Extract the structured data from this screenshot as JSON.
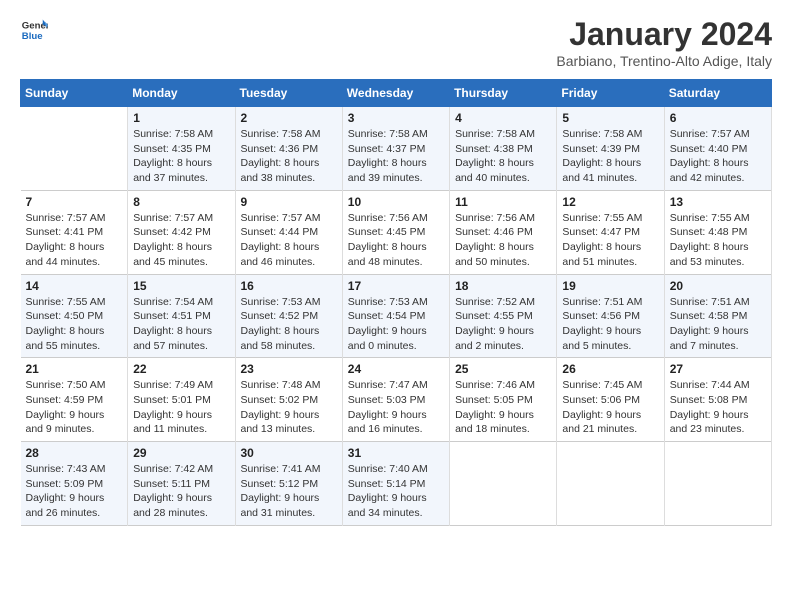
{
  "header": {
    "logo": {
      "line1": "General",
      "line2": "Blue"
    },
    "title": "January 2024",
    "location": "Barbiano, Trentino-Alto Adige, Italy"
  },
  "weekdays": [
    "Sunday",
    "Monday",
    "Tuesday",
    "Wednesday",
    "Thursday",
    "Friday",
    "Saturday"
  ],
  "weeks": [
    [
      {
        "day": "",
        "sunrise": "",
        "sunset": "",
        "daylight": ""
      },
      {
        "day": "1",
        "sunrise": "Sunrise: 7:58 AM",
        "sunset": "Sunset: 4:35 PM",
        "daylight": "Daylight: 8 hours and 37 minutes."
      },
      {
        "day": "2",
        "sunrise": "Sunrise: 7:58 AM",
        "sunset": "Sunset: 4:36 PM",
        "daylight": "Daylight: 8 hours and 38 minutes."
      },
      {
        "day": "3",
        "sunrise": "Sunrise: 7:58 AM",
        "sunset": "Sunset: 4:37 PM",
        "daylight": "Daylight: 8 hours and 39 minutes."
      },
      {
        "day": "4",
        "sunrise": "Sunrise: 7:58 AM",
        "sunset": "Sunset: 4:38 PM",
        "daylight": "Daylight: 8 hours and 40 minutes."
      },
      {
        "day": "5",
        "sunrise": "Sunrise: 7:58 AM",
        "sunset": "Sunset: 4:39 PM",
        "daylight": "Daylight: 8 hours and 41 minutes."
      },
      {
        "day": "6",
        "sunrise": "Sunrise: 7:57 AM",
        "sunset": "Sunset: 4:40 PM",
        "daylight": "Daylight: 8 hours and 42 minutes."
      }
    ],
    [
      {
        "day": "7",
        "sunrise": "Sunrise: 7:57 AM",
        "sunset": "Sunset: 4:41 PM",
        "daylight": "Daylight: 8 hours and 44 minutes."
      },
      {
        "day": "8",
        "sunrise": "Sunrise: 7:57 AM",
        "sunset": "Sunset: 4:42 PM",
        "daylight": "Daylight: 8 hours and 45 minutes."
      },
      {
        "day": "9",
        "sunrise": "Sunrise: 7:57 AM",
        "sunset": "Sunset: 4:44 PM",
        "daylight": "Daylight: 8 hours and 46 minutes."
      },
      {
        "day": "10",
        "sunrise": "Sunrise: 7:56 AM",
        "sunset": "Sunset: 4:45 PM",
        "daylight": "Daylight: 8 hours and 48 minutes."
      },
      {
        "day": "11",
        "sunrise": "Sunrise: 7:56 AM",
        "sunset": "Sunset: 4:46 PM",
        "daylight": "Daylight: 8 hours and 50 minutes."
      },
      {
        "day": "12",
        "sunrise": "Sunrise: 7:55 AM",
        "sunset": "Sunset: 4:47 PM",
        "daylight": "Daylight: 8 hours and 51 minutes."
      },
      {
        "day": "13",
        "sunrise": "Sunrise: 7:55 AM",
        "sunset": "Sunset: 4:48 PM",
        "daylight": "Daylight: 8 hours and 53 minutes."
      }
    ],
    [
      {
        "day": "14",
        "sunrise": "Sunrise: 7:55 AM",
        "sunset": "Sunset: 4:50 PM",
        "daylight": "Daylight: 8 hours and 55 minutes."
      },
      {
        "day": "15",
        "sunrise": "Sunrise: 7:54 AM",
        "sunset": "Sunset: 4:51 PM",
        "daylight": "Daylight: 8 hours and 57 minutes."
      },
      {
        "day": "16",
        "sunrise": "Sunrise: 7:53 AM",
        "sunset": "Sunset: 4:52 PM",
        "daylight": "Daylight: 8 hours and 58 minutes."
      },
      {
        "day": "17",
        "sunrise": "Sunrise: 7:53 AM",
        "sunset": "Sunset: 4:54 PM",
        "daylight": "Daylight: 9 hours and 0 minutes."
      },
      {
        "day": "18",
        "sunrise": "Sunrise: 7:52 AM",
        "sunset": "Sunset: 4:55 PM",
        "daylight": "Daylight: 9 hours and 2 minutes."
      },
      {
        "day": "19",
        "sunrise": "Sunrise: 7:51 AM",
        "sunset": "Sunset: 4:56 PM",
        "daylight": "Daylight: 9 hours and 5 minutes."
      },
      {
        "day": "20",
        "sunrise": "Sunrise: 7:51 AM",
        "sunset": "Sunset: 4:58 PM",
        "daylight": "Daylight: 9 hours and 7 minutes."
      }
    ],
    [
      {
        "day": "21",
        "sunrise": "Sunrise: 7:50 AM",
        "sunset": "Sunset: 4:59 PM",
        "daylight": "Daylight: 9 hours and 9 minutes."
      },
      {
        "day": "22",
        "sunrise": "Sunrise: 7:49 AM",
        "sunset": "Sunset: 5:01 PM",
        "daylight": "Daylight: 9 hours and 11 minutes."
      },
      {
        "day": "23",
        "sunrise": "Sunrise: 7:48 AM",
        "sunset": "Sunset: 5:02 PM",
        "daylight": "Daylight: 9 hours and 13 minutes."
      },
      {
        "day": "24",
        "sunrise": "Sunrise: 7:47 AM",
        "sunset": "Sunset: 5:03 PM",
        "daylight": "Daylight: 9 hours and 16 minutes."
      },
      {
        "day": "25",
        "sunrise": "Sunrise: 7:46 AM",
        "sunset": "Sunset: 5:05 PM",
        "daylight": "Daylight: 9 hours and 18 minutes."
      },
      {
        "day": "26",
        "sunrise": "Sunrise: 7:45 AM",
        "sunset": "Sunset: 5:06 PM",
        "daylight": "Daylight: 9 hours and 21 minutes."
      },
      {
        "day": "27",
        "sunrise": "Sunrise: 7:44 AM",
        "sunset": "Sunset: 5:08 PM",
        "daylight": "Daylight: 9 hours and 23 minutes."
      }
    ],
    [
      {
        "day": "28",
        "sunrise": "Sunrise: 7:43 AM",
        "sunset": "Sunset: 5:09 PM",
        "daylight": "Daylight: 9 hours and 26 minutes."
      },
      {
        "day": "29",
        "sunrise": "Sunrise: 7:42 AM",
        "sunset": "Sunset: 5:11 PM",
        "daylight": "Daylight: 9 hours and 28 minutes."
      },
      {
        "day": "30",
        "sunrise": "Sunrise: 7:41 AM",
        "sunset": "Sunset: 5:12 PM",
        "daylight": "Daylight: 9 hours and 31 minutes."
      },
      {
        "day": "31",
        "sunrise": "Sunrise: 7:40 AM",
        "sunset": "Sunset: 5:14 PM",
        "daylight": "Daylight: 9 hours and 34 minutes."
      },
      {
        "day": "",
        "sunrise": "",
        "sunset": "",
        "daylight": ""
      },
      {
        "day": "",
        "sunrise": "",
        "sunset": "",
        "daylight": ""
      },
      {
        "day": "",
        "sunrise": "",
        "sunset": "",
        "daylight": ""
      }
    ]
  ]
}
